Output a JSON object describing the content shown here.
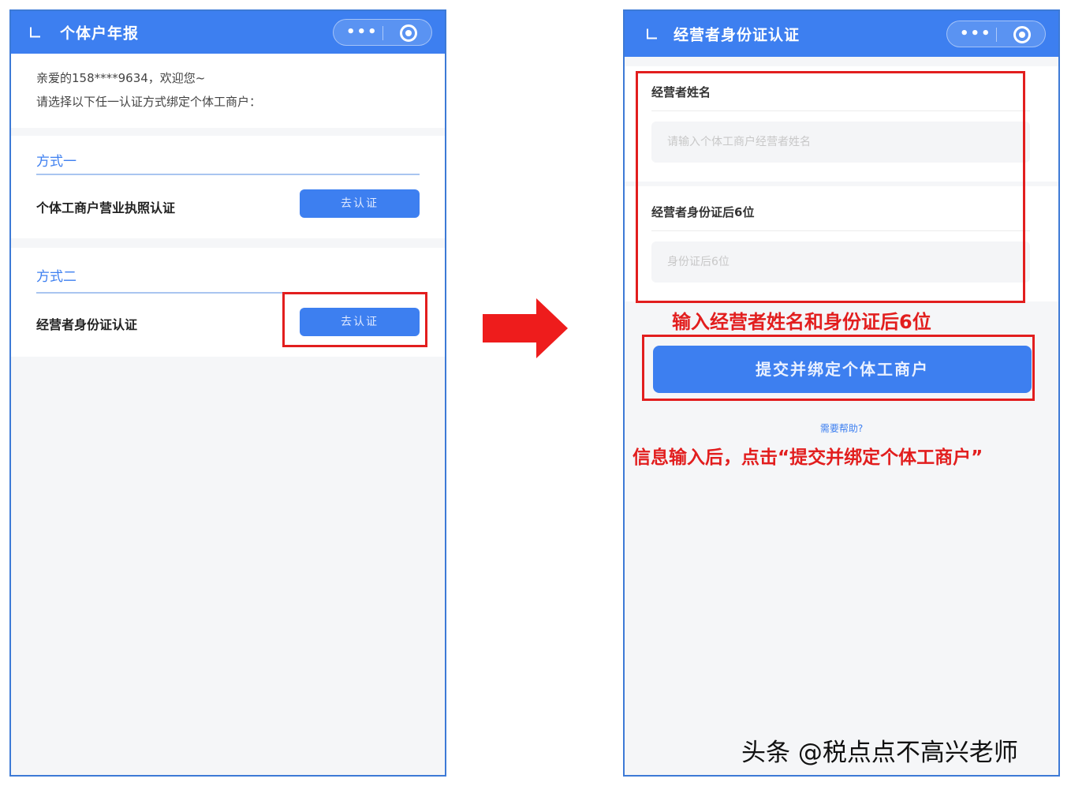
{
  "left_screen": {
    "title": "个体户年报",
    "greeting": "亲爱的158****9634，欢迎您~",
    "instruction": "请选择以下任一认证方式绑定个体工商户：",
    "method1": {
      "title": "方式一",
      "label": "个体工商户营业执照认证",
      "button": "去认证"
    },
    "method2": {
      "title": "方式二",
      "label": "经营者身份证认证",
      "button": "去认证"
    }
  },
  "right_screen": {
    "title": "经营者身份证认证",
    "name_field": {
      "label": "经营者姓名",
      "placeholder": "请输入个体工商户经营者姓名"
    },
    "id_field": {
      "label": "经营者身份证后6位",
      "placeholder": "身份证后6位"
    },
    "submit_button": "提交并绑定个体工商户",
    "help_link": "需要帮助?"
  },
  "annotations": {
    "note_input": "输入经营者姓名和身份证后6位",
    "note_submit": "信息输入后，点击“提交并绑定个体工商户”",
    "highlight_color": "#e21e1e"
  },
  "watermark": "头条 @税点点不高兴老师"
}
